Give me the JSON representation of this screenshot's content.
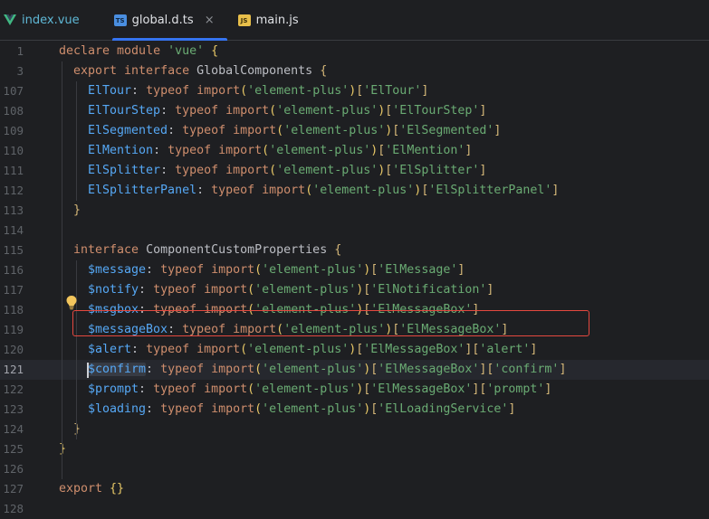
{
  "tabs": [
    {
      "label": "index.vue",
      "icon": "vue-icon"
    },
    {
      "label": "global.d.ts",
      "icon": "ts-file-icon",
      "badge": "TS",
      "close": "×"
    },
    {
      "label": "main.js",
      "icon": "js-file-icon",
      "badge": "JS"
    }
  ],
  "colors": {
    "keyword": "#cf8e6d",
    "string": "#6aab73",
    "property": "#56a8f5",
    "bracket": "#e8c867",
    "highlight_box": "#e5483f",
    "tab_accent": "#3574f0"
  },
  "lines": [
    {
      "num": "1",
      "indent": 0,
      "tokens": [
        [
          "kw",
          "declare module "
        ],
        [
          "str",
          "'vue'"
        ],
        [
          "bc",
          " {"
        ]
      ]
    },
    {
      "num": "3",
      "indent": 1,
      "tokens": [
        [
          "kw",
          "export interface "
        ],
        [
          "bi",
          "GlobalComponents "
        ],
        [
          "bv",
          "{"
        ]
      ]
    },
    {
      "num": "107",
      "indent": 2,
      "tokens": [
        [
          "fn",
          "ElTour"
        ],
        [
          "bi",
          ": "
        ],
        [
          "kw",
          "typeof "
        ],
        [
          "kw",
          "import"
        ],
        [
          "bc",
          "("
        ],
        [
          "str",
          "'element-plus'"
        ],
        [
          "bc",
          ")"
        ],
        [
          "bv",
          "["
        ],
        [
          "str",
          "'ElTour'"
        ],
        [
          "bv",
          "]"
        ]
      ]
    },
    {
      "num": "108",
      "indent": 2,
      "tokens": [
        [
          "fn",
          "ElTourStep"
        ],
        [
          "bi",
          ": "
        ],
        [
          "kw",
          "typeof "
        ],
        [
          "kw",
          "import"
        ],
        [
          "bc",
          "("
        ],
        [
          "str",
          "'element-plus'"
        ],
        [
          "bc",
          ")"
        ],
        [
          "bv",
          "["
        ],
        [
          "str",
          "'ElTourStep'"
        ],
        [
          "bv",
          "]"
        ]
      ]
    },
    {
      "num": "109",
      "indent": 2,
      "tokens": [
        [
          "fn",
          "ElSegmented"
        ],
        [
          "bi",
          ": "
        ],
        [
          "kw",
          "typeof "
        ],
        [
          "kw",
          "import"
        ],
        [
          "bc",
          "("
        ],
        [
          "str",
          "'element-plus'"
        ],
        [
          "bc",
          ")"
        ],
        [
          "bv",
          "["
        ],
        [
          "str",
          "'ElSegmented'"
        ],
        [
          "bv",
          "]"
        ]
      ]
    },
    {
      "num": "110",
      "indent": 2,
      "tokens": [
        [
          "fn",
          "ElMention"
        ],
        [
          "bi",
          ": "
        ],
        [
          "kw",
          "typeof "
        ],
        [
          "kw",
          "import"
        ],
        [
          "bc",
          "("
        ],
        [
          "str",
          "'element-plus'"
        ],
        [
          "bc",
          ")"
        ],
        [
          "bv",
          "["
        ],
        [
          "str",
          "'ElMention'"
        ],
        [
          "bv",
          "]"
        ]
      ]
    },
    {
      "num": "111",
      "indent": 2,
      "tokens": [
        [
          "fn",
          "ElSplitter"
        ],
        [
          "bi",
          ": "
        ],
        [
          "kw",
          "typeof "
        ],
        [
          "kw",
          "import"
        ],
        [
          "bc",
          "("
        ],
        [
          "str",
          "'element-plus'"
        ],
        [
          "bc",
          ")"
        ],
        [
          "bv",
          "["
        ],
        [
          "str",
          "'ElSplitter'"
        ],
        [
          "bv",
          "]"
        ]
      ]
    },
    {
      "num": "112",
      "indent": 2,
      "tokens": [
        [
          "fn",
          "ElSplitterPanel"
        ],
        [
          "bi",
          ": "
        ],
        [
          "kw",
          "typeof "
        ],
        [
          "kw",
          "import"
        ],
        [
          "bc",
          "("
        ],
        [
          "str",
          "'element-plus'"
        ],
        [
          "bc",
          ")"
        ],
        [
          "bv",
          "["
        ],
        [
          "str",
          "'ElSplitterPanel'"
        ],
        [
          "bv",
          "]"
        ]
      ]
    },
    {
      "num": "113",
      "indent": 1,
      "tokens": [
        [
          "bv",
          "}"
        ]
      ]
    },
    {
      "num": "114",
      "indent": 0,
      "tokens": []
    },
    {
      "num": "115",
      "indent": 1,
      "tokens": [
        [
          "kw",
          "interface "
        ],
        [
          "bi",
          "ComponentCustomProperties "
        ],
        [
          "bv",
          "{"
        ]
      ]
    },
    {
      "num": "116",
      "indent": 2,
      "tokens": [
        [
          "fn",
          "$message"
        ],
        [
          "bi",
          ": "
        ],
        [
          "kw",
          "typeof "
        ],
        [
          "kw",
          "import"
        ],
        [
          "bc",
          "("
        ],
        [
          "str",
          "'element-plus'"
        ],
        [
          "bc",
          ")"
        ],
        [
          "bv",
          "["
        ],
        [
          "str",
          "'ElMessage'"
        ],
        [
          "bv",
          "]"
        ]
      ]
    },
    {
      "num": "117",
      "indent": 2,
      "tokens": [
        [
          "fn",
          "$notify"
        ],
        [
          "bi",
          ": "
        ],
        [
          "kw",
          "typeof "
        ],
        [
          "kw",
          "import"
        ],
        [
          "bc",
          "("
        ],
        [
          "str",
          "'element-plus'"
        ],
        [
          "bc",
          ")"
        ],
        [
          "bv",
          "["
        ],
        [
          "str",
          "'ElNotification'"
        ],
        [
          "bv",
          "]"
        ]
      ]
    },
    {
      "num": "118",
      "indent": 2,
      "tokens": [
        [
          "fn",
          "$msgbox"
        ],
        [
          "bi",
          ": "
        ],
        [
          "kw",
          "typeof "
        ],
        [
          "kw",
          "import"
        ],
        [
          "bc",
          "("
        ],
        [
          "str",
          "'element-plus'"
        ],
        [
          "bc",
          ")"
        ],
        [
          "bv",
          "["
        ],
        [
          "str",
          "'ElMessageBox'"
        ],
        [
          "bv",
          "]"
        ]
      ]
    },
    {
      "num": "119",
      "indent": 2,
      "tokens": [
        [
          "fn",
          "$messageBox"
        ],
        [
          "bi",
          ": "
        ],
        [
          "kw",
          "typeof "
        ],
        [
          "kw",
          "import"
        ],
        [
          "bc",
          "("
        ],
        [
          "str",
          "'element-plus'"
        ],
        [
          "bc",
          ")"
        ],
        [
          "bv",
          "["
        ],
        [
          "str",
          "'ElMessageBox'"
        ],
        [
          "bv",
          "]"
        ]
      ]
    },
    {
      "num": "120",
      "indent": 2,
      "tokens": [
        [
          "fn",
          "$alert"
        ],
        [
          "bi",
          ": "
        ],
        [
          "kw",
          "typeof "
        ],
        [
          "kw",
          "import"
        ],
        [
          "bc",
          "("
        ],
        [
          "str",
          "'element-plus'"
        ],
        [
          "bc",
          ")"
        ],
        [
          "bv",
          "["
        ],
        [
          "str",
          "'ElMessageBox'"
        ],
        [
          "bv",
          "]["
        ],
        [
          "str",
          "'alert'"
        ],
        [
          "bv",
          "]"
        ]
      ]
    },
    {
      "num": "121",
      "indent": 2,
      "current": true,
      "tokens": [
        [
          "fn idh",
          "$confirm"
        ],
        [
          "bi",
          ": "
        ],
        [
          "kw",
          "typeof "
        ],
        [
          "kw",
          "import"
        ],
        [
          "bc",
          "("
        ],
        [
          "str",
          "'element-plus'"
        ],
        [
          "bc",
          ")"
        ],
        [
          "bv",
          "["
        ],
        [
          "str",
          "'ElMessageBox'"
        ],
        [
          "bv",
          "]["
        ],
        [
          "str",
          "'confirm'"
        ],
        [
          "bv",
          "]"
        ]
      ]
    },
    {
      "num": "122",
      "indent": 2,
      "tokens": [
        [
          "fn",
          "$prompt"
        ],
        [
          "bi",
          ": "
        ],
        [
          "kw",
          "typeof "
        ],
        [
          "kw",
          "import"
        ],
        [
          "bc",
          "("
        ],
        [
          "str",
          "'element-plus'"
        ],
        [
          "bc",
          ")"
        ],
        [
          "bv",
          "["
        ],
        [
          "str",
          "'ElMessageBox'"
        ],
        [
          "bv",
          "]["
        ],
        [
          "str",
          "'prompt'"
        ],
        [
          "bv",
          "]"
        ]
      ]
    },
    {
      "num": "123",
      "indent": 2,
      "tokens": [
        [
          "fn",
          "$loading"
        ],
        [
          "bi",
          ": "
        ],
        [
          "kw",
          "typeof "
        ],
        [
          "kw",
          "import"
        ],
        [
          "bc",
          "("
        ],
        [
          "str",
          "'element-plus'"
        ],
        [
          "bc",
          ")"
        ],
        [
          "bv",
          "["
        ],
        [
          "str",
          "'ElLoadingService'"
        ],
        [
          "bv",
          "]"
        ]
      ]
    },
    {
      "num": "124",
      "indent": 1,
      "tokens": [
        [
          "bv",
          "}"
        ]
      ]
    },
    {
      "num": "125",
      "indent": 0,
      "tokens": [
        [
          "bc",
          "}"
        ]
      ]
    },
    {
      "num": "126",
      "indent": 0,
      "tokens": []
    },
    {
      "num": "127",
      "indent": 0,
      "tokens": [
        [
          "kw",
          "export "
        ],
        [
          "bc",
          "{}"
        ]
      ]
    },
    {
      "num": "128",
      "indent": 0,
      "tokens": []
    }
  ],
  "lightbulb": {
    "line": "120",
    "icon": "lightbulb-icon"
  },
  "highlight_box": {
    "line": "121"
  }
}
